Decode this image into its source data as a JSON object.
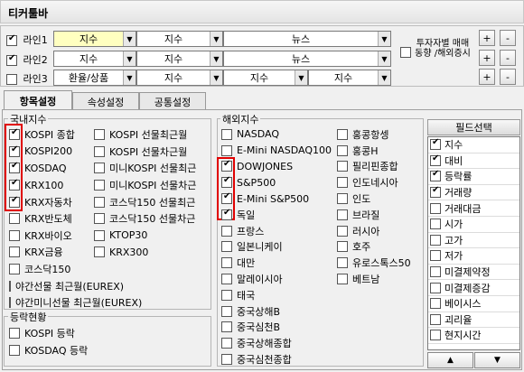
{
  "title": "티커툴바",
  "lines": [
    {
      "label": "라인1",
      "checked": true,
      "combo1": "지수",
      "combo2": "지수",
      "combo3": "뉴스"
    },
    {
      "label": "라인2",
      "checked": true,
      "combo1": "지수",
      "combo2": "지수",
      "combo3": "뉴스"
    },
    {
      "label": "라인3",
      "checked": false,
      "combo1": "환율/상품",
      "combo2": "지수",
      "combo3": "지수",
      "combo4": "지수"
    }
  ],
  "investor": {
    "label": "투자자별 매매동향 /해외증시",
    "checked": false
  },
  "buttons": {
    "plus": "+",
    "minus": "-"
  },
  "tabs": [
    "항목설정",
    "속성설정",
    "공통설정"
  ],
  "domestic": {
    "label": "국내지수",
    "col1": [
      {
        "label": "KOSPI 종합",
        "checked": true
      },
      {
        "label": "KOSPI200",
        "checked": true
      },
      {
        "label": "KOSDAQ",
        "checked": true
      },
      {
        "label": "KRX100",
        "checked": true
      },
      {
        "label": "KRX자동차",
        "checked": true
      },
      {
        "label": "KRX반도체",
        "checked": false
      },
      {
        "label": "KRX바이오",
        "checked": false
      },
      {
        "label": "KRX금융",
        "checked": false
      },
      {
        "label": "코스닥150",
        "checked": false
      },
      {
        "label": "야간선물 최근월(EUREX)",
        "checked": false
      },
      {
        "label": "야간미니선물 최근월(EUREX)",
        "checked": false
      }
    ],
    "col2": [
      {
        "label": "KOSPI 선물최근월",
        "checked": false
      },
      {
        "label": "KOSPI 선물차근월",
        "checked": false
      },
      {
        "label": "미니KOSPI 선물최근",
        "checked": false
      },
      {
        "label": "미니KOSPI 선물차근",
        "checked": false
      },
      {
        "label": "코스닥150 선물최근",
        "checked": false
      },
      {
        "label": "코스닥150 선물차근",
        "checked": false
      },
      {
        "label": "KTOP30",
        "checked": false
      },
      {
        "label": "KRX300",
        "checked": false
      }
    ]
  },
  "updown": {
    "label": "등락현황",
    "items": [
      {
        "label": "KOSPI 등락",
        "checked": false
      },
      {
        "label": "KOSDAQ 등락",
        "checked": false
      }
    ]
  },
  "overseas": {
    "label": "해외지수",
    "col1": [
      {
        "label": "NASDAQ",
        "checked": false
      },
      {
        "label": "E-Mini NASDAQ100",
        "checked": false
      },
      {
        "label": "DOWJONES",
        "checked": true
      },
      {
        "label": "S&P500",
        "checked": true
      },
      {
        "label": "E-Mini S&P500",
        "checked": true
      },
      {
        "label": "독일",
        "checked": true
      },
      {
        "label": "프랑스",
        "checked": false
      },
      {
        "label": "일본니케이",
        "checked": false
      },
      {
        "label": "대만",
        "checked": false
      },
      {
        "label": "말레이시아",
        "checked": false
      },
      {
        "label": "태국",
        "checked": false
      },
      {
        "label": "중국상해B",
        "checked": false
      },
      {
        "label": "중국심천B",
        "checked": false
      },
      {
        "label": "중국상해종합",
        "checked": false
      },
      {
        "label": "중국심천종합",
        "checked": false
      }
    ],
    "col2": [
      {
        "label": "홍콩항셍",
        "checked": false
      },
      {
        "label": "홍콩H",
        "checked": false
      },
      {
        "label": "필리핀종합",
        "checked": false
      },
      {
        "label": "인도네시아",
        "checked": false
      },
      {
        "label": "인도",
        "checked": false
      },
      {
        "label": "브라질",
        "checked": false
      },
      {
        "label": "러시아",
        "checked": false
      },
      {
        "label": "호주",
        "checked": false
      },
      {
        "label": "유로스톡스50",
        "checked": false
      },
      {
        "label": "베트남",
        "checked": false
      }
    ]
  },
  "fields": {
    "header": "필드선택",
    "items": [
      {
        "label": "지수",
        "checked": true
      },
      {
        "label": "대비",
        "checked": true
      },
      {
        "label": "등락률",
        "checked": true
      },
      {
        "label": "거래량",
        "checked": true
      },
      {
        "label": "거래대금",
        "checked": false
      },
      {
        "label": "시가",
        "checked": false
      },
      {
        "label": "고가",
        "checked": false
      },
      {
        "label": "저가",
        "checked": false
      },
      {
        "label": "미결제약정",
        "checked": false
      },
      {
        "label": "미결제증감",
        "checked": false
      },
      {
        "label": "베이시스",
        "checked": false
      },
      {
        "label": "괴리율",
        "checked": false
      },
      {
        "label": "현지시간",
        "checked": false
      }
    ],
    "up": "▲",
    "down": "▼"
  }
}
